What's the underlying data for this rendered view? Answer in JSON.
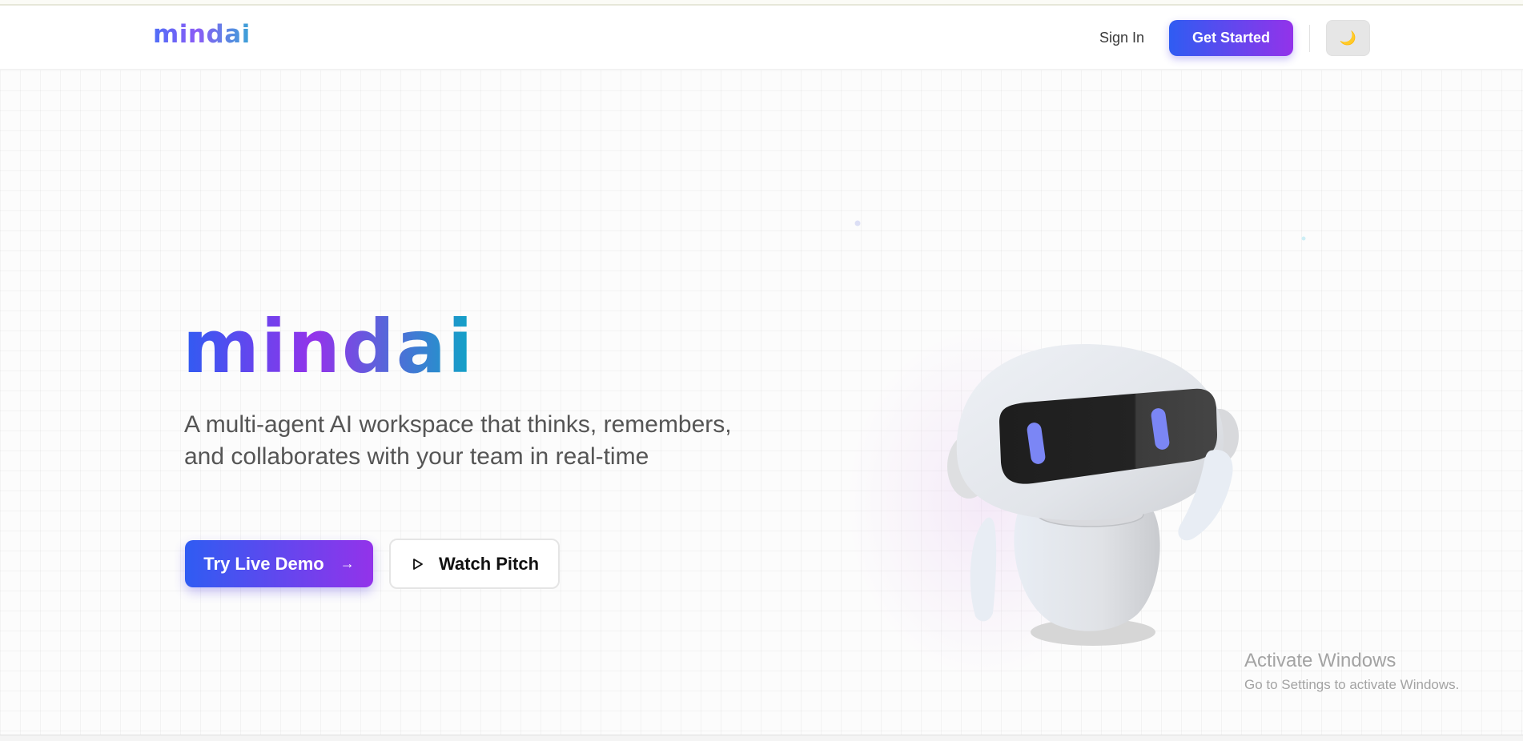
{
  "nav": {
    "logo": "mindai",
    "sign_in": "Sign In",
    "get_started": "Get Started",
    "theme_toggle_icon": "moon-icon"
  },
  "hero": {
    "title": "mindai",
    "subtitle": "A multi-agent AI workspace that thinks, remembers, and collaborates with your team in real-time",
    "primary_button": "Try Live Demo",
    "primary_icon": "arrow-right-icon",
    "secondary_button": "Watch Pitch",
    "secondary_icon": "play-icon"
  },
  "overlay": {
    "title": "Activate Windows",
    "subtitle": "Go to Settings to activate Windows."
  },
  "colors": {
    "brand_blue": "#2f5cf2",
    "brand_purple": "#9333ea",
    "brand_teal": "#0ea5c6"
  }
}
